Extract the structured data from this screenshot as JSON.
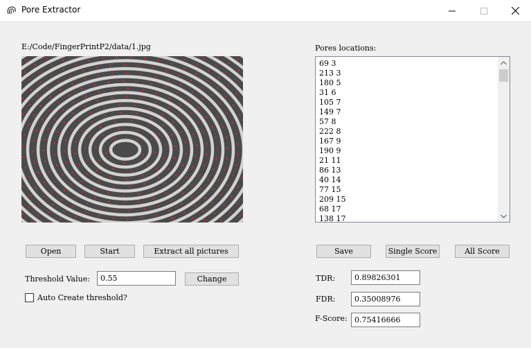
{
  "window": {
    "title": "Pore Extractor"
  },
  "image_path": "E:/Code/FingerPrintP2/data/1.jpg",
  "buttons": {
    "open": "Open",
    "start": "Start",
    "extract_all": "Extract all pictures",
    "save": "Save",
    "single_score": "Single Score",
    "all_score": "All Score",
    "change": "Change"
  },
  "threshold": {
    "label": "Threshold Value:",
    "value": "0.55"
  },
  "auto_threshold": {
    "label": "Auto Create threshold?",
    "checked": false
  },
  "pores": {
    "label": "Pores locations:",
    "items": [
      "69 3",
      "213 3",
      "180 5",
      "31 6",
      "105 7",
      "149 7",
      "57 8",
      "222 8",
      "167 9",
      "190 9",
      "21 11",
      "86 13",
      "40 14",
      "77 15",
      "209 15",
      "68 17",
      "138 17"
    ]
  },
  "metrics": {
    "tdr": {
      "label": "TDR:",
      "value": "0.89826301"
    },
    "fdr": {
      "label": "FDR:",
      "value": "0.35008976"
    },
    "fscore": {
      "label": "F-Score:",
      "value": "0.75416666"
    }
  },
  "colors": {
    "pore_marker": "#c0303a",
    "ridge": "#262626",
    "valley": "#d2d2d2"
  },
  "icons": {
    "app": "fingerprint-icon",
    "minimize": "minimize-icon",
    "maximize": "maximize-icon",
    "close": "close-icon"
  }
}
